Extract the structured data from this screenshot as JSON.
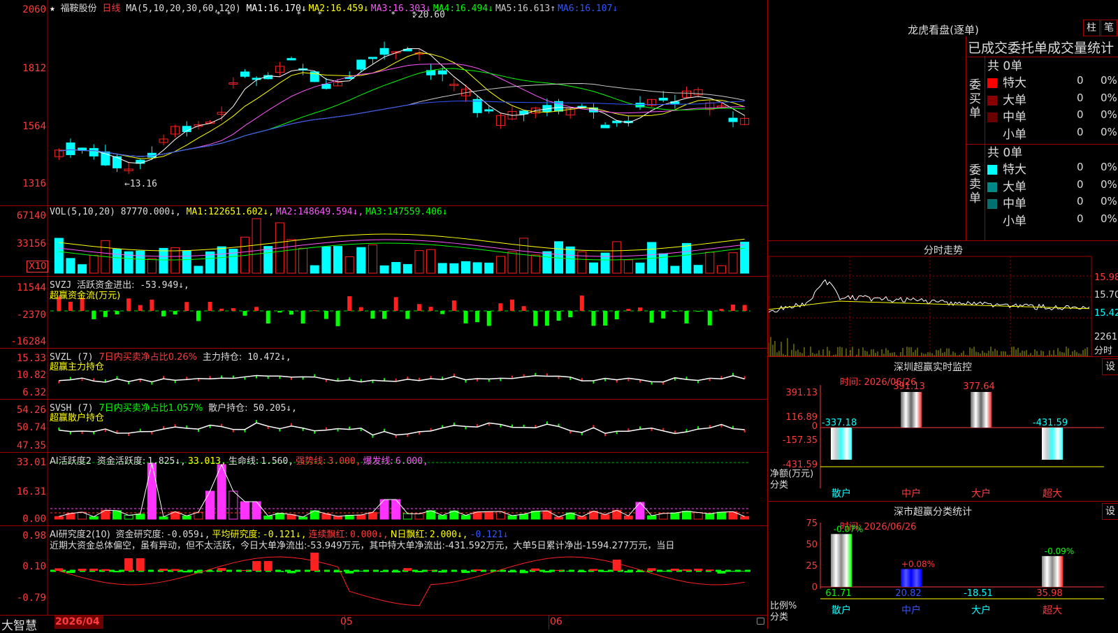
{
  "kline": {
    "star": "★",
    "stock_name": "福鞍股份",
    "period": "日线",
    "ma_label": "MA(5,10,20,30,60,120)",
    "ma": [
      {
        "k": "MA1:",
        "v": "16.170↓",
        "c": "#ffffff"
      },
      {
        "k": "MA2:",
        "v": "16.459↓",
        "c": "#ffff00"
      },
      {
        "k": "MA3:",
        "v": "16.303↓",
        "c": "#ff55ff"
      },
      {
        "k": "MA4:",
        "v": "16.494↓",
        "c": "#00ff00"
      },
      {
        "k": "MA5:",
        "v": "16.613↑",
        "c": "#cccccc"
      },
      {
        "k": "MA6:",
        "v": "16.107↓",
        "c": "#3355ff"
      }
    ],
    "axis": [
      "2060",
      "1812",
      "1564",
      "1316"
    ],
    "high_label": "20.60",
    "low_label": "13.16"
  },
  "vol": {
    "label": "VOL(5,10,20)",
    "value": "87770.000↓,",
    "ma": [
      {
        "k": "MA1:",
        "v": "122651.602↓,",
        "c": "#ffff00"
      },
      {
        "k": "MA2:",
        "v": "148649.594↓,",
        "c": "#ff55ff"
      },
      {
        "k": "MA3:",
        "v": "147559.406↓",
        "c": "#00ff00"
      }
    ],
    "axis": [
      "67140",
      "33156"
    ],
    "x10": "X10"
  },
  "svzj": {
    "label": "SVZJ",
    "item": "活跃资金进出:",
    "value": "-53.949↓,",
    "title": "超赢资金流(万元)",
    "axis": [
      "11544",
      "-2370",
      "-16284"
    ]
  },
  "svzl": {
    "label": "SVZL (7)",
    "desc": "7日内买卖净占比0.26%",
    "item": "主力持仓:",
    "value": "10.472↓,",
    "title": "超赢主力持仓",
    "axis": [
      "15.33",
      "10.82",
      "6.32"
    ]
  },
  "svsh": {
    "label": "SVSH (7)",
    "desc": "7日内买卖净占比1.057%",
    "item": "散户持仓:",
    "value": "50.205↓,",
    "title": "超赢散户持仓",
    "axis": [
      "54.26",
      "50.74",
      "47.35"
    ]
  },
  "ai1": {
    "label": "AI活跃度2",
    "items": [
      {
        "t": "资金活跃度:",
        "c": "#dddddd"
      },
      {
        "t": "1.825↓,",
        "c": "#dddddd"
      },
      {
        "t": "33.013,",
        "c": "#ffff00"
      },
      {
        "t": "生命线:",
        "c": "#dddddd"
      },
      {
        "t": "1.560,",
        "c": "#dddddd"
      },
      {
        "t": "强势线:",
        "c": "#ff3b3b"
      },
      {
        "t": "3.000,",
        "c": "#ff3b3b"
      },
      {
        "t": "爆发线:",
        "c": "#ff55ff"
      },
      {
        "t": "6.000,",
        "c": "#ff55ff"
      }
    ],
    "axis": [
      "33.01",
      "16.31",
      "0.00"
    ]
  },
  "ai2": {
    "label": "AI研究度2(10)",
    "items": [
      {
        "t": "资金研究度:",
        "c": "#dddddd"
      },
      {
        "t": "-0.059↓,",
        "c": "#dddddd"
      },
      {
        "t": "平均研究度:",
        "c": "#ffff00"
      },
      {
        "t": "-0.121↓,",
        "c": "#ffff00"
      },
      {
        "t": "连续飘红:",
        "c": "#ff3b3b"
      },
      {
        "t": "0.000↓,",
        "c": "#ff3b3b"
      },
      {
        "t": "N日飘红:",
        "c": "#ffff00"
      },
      {
        "t": "2.000↓,",
        "c": "#ffff00"
      },
      {
        "t": "-0.121↓",
        "c": "#3355ff"
      }
    ],
    "comment": "近期大资金总体偏空，虽有异动，但不太活跃，今日大单净流出:-53.949万元，其中特大单净流出:-431.592万元，大单5日累计净出-1594.277万元，当日",
    "axis": [
      "0.98",
      "0.10",
      "-0.79"
    ]
  },
  "bottom": {
    "brand": "大智慧",
    "date": "2026/04",
    "m1": "05",
    "m2": "06"
  },
  "right": {
    "lhb_title": "龙虎看盘(逐单)",
    "btn1": "柱",
    "btn2": "笔",
    "stats_title": "已成交委托单成交量统计",
    "buy_label": "委买单",
    "sell_label": "委卖单",
    "buy_total": "共 0单",
    "sell_total": "共 0单",
    "buy_rows": [
      {
        "name": "特大",
        "val": "0",
        "pct": "0%",
        "c": "#ff0000"
      },
      {
        "name": "大单",
        "val": "0",
        "pct": "0%",
        "c": "#8a0000"
      },
      {
        "name": "中单",
        "val": "0",
        "pct": "0%",
        "c": "#6a0000"
      },
      {
        "name": "小单",
        "val": "0",
        "pct": "0%",
        "c": ""
      }
    ],
    "sell_rows": [
      {
        "name": "特大",
        "val": "0",
        "pct": "0%",
        "c": "#00ffff"
      },
      {
        "name": "大单",
        "val": "0",
        "pct": "0%",
        "c": "#008888"
      },
      {
        "name": "中单",
        "val": "0",
        "pct": "0%",
        "c": "#007070"
      },
      {
        "name": "小单",
        "val": "0",
        "pct": "0%",
        "c": ""
      }
    ],
    "fs_title": "分时走势",
    "fs_axis": [
      "15.98",
      "15.70",
      "15.42",
      "2261"
    ],
    "fs_unit": "分时",
    "mon_title": "深圳超赢实时监控",
    "mon_set": "设",
    "mon_time": "时间: 2026/06/26",
    "mon_axis": [
      "391.13",
      "116.89",
      "0",
      "-157.35",
      "-431.59"
    ],
    "mon_ylabel": "净额(万元)",
    "mon_xlabel": "分类",
    "mon_bars": [
      {
        "cat": "散户",
        "val": "-337.18"
      },
      {
        "cat": "中户",
        "val": "391.13"
      },
      {
        "cat": "大户",
        "val": "377.64"
      },
      {
        "cat": "超大",
        "val": "-431.59"
      }
    ],
    "cls_title": "深市超赢分类统计",
    "cls_set": "设",
    "cls_time": "时间: 2026/06/26",
    "cls_axis": [
      "75",
      "50",
      "25",
      "0"
    ],
    "cls_ylabel": "比例%",
    "cls_xlabel": "分类",
    "cls_bars": [
      {
        "cat": "散户",
        "val": "61.71",
        "delta": "-0.07%"
      },
      {
        "cat": "中户",
        "val": "20.82",
        "delta": "+0.08%"
      },
      {
        "cat": "大户",
        "val": "-18.51",
        "delta": ""
      },
      {
        "cat": "超大",
        "val": "35.98",
        "delta": "-0.09%"
      }
    ]
  }
}
